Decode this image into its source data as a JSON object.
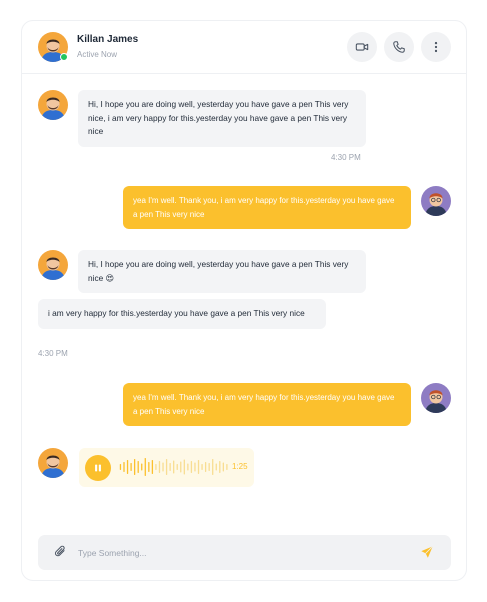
{
  "contact": {
    "name": "Killan James",
    "status": "Active Now"
  },
  "header_actions": [
    {
      "icon": "video-camera-icon"
    },
    {
      "icon": "phone-icon"
    },
    {
      "icon": "more-vertical-icon"
    }
  ],
  "messages": [
    {
      "direction": "in",
      "text": "Hi, I hope you are doing well, yesterday you have gave a pen This very nice, i am very happy for this.yesterday you have gave a pen This very nice"
    },
    {
      "direction": "in",
      "time": "4:30 PM"
    },
    {
      "direction": "out",
      "text": "yea I'm well. Thank you, i am very happy for this.yesterday you have gave a pen This very nice"
    },
    {
      "direction": "in",
      "text": "Hi, I hope you are doing well, yesterday you have gave a pen This very nice 😍"
    },
    {
      "direction": "in",
      "text": "i am very happy for this.yesterday you have gave a pen This very nice"
    },
    {
      "direction": "in",
      "time": "4:30 PM"
    },
    {
      "direction": "out",
      "text": "yea I'm well. Thank you, i am very happy for this.yesterday you have gave a pen This very nice"
    }
  ],
  "voice_message": {
    "duration": "1:25",
    "played_fraction": 0.32
  },
  "composer": {
    "placeholder": "Type Something...",
    "value": ""
  },
  "colors": {
    "accent": "#fbc02d",
    "online": "#22c55e",
    "incoming_bubble": "#f3f4f6"
  }
}
